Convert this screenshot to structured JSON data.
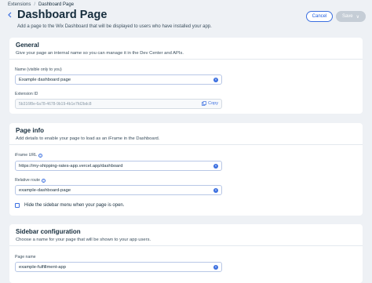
{
  "breadcrumbs": {
    "parent": "Extensions",
    "separator": "/",
    "current": "Dashboard Page"
  },
  "header": {
    "title": "Dashboard Page",
    "subtitle": "Add a page to the Wix Dashboard that will be displayed to users who have installed your app.",
    "cancel_label": "Cancel",
    "save_label": "Save",
    "save_chevron": "∨"
  },
  "general": {
    "title": "General",
    "description": "Give your page an internal name so you can manage it in the Dev Center and APIs.",
    "name_label": "Name (visible only to you)",
    "name_value": "Example dashboard page",
    "extension_id_label": "Extension ID",
    "extension_id_value": "5b316f8e-6a78-4678-9b19-4b1e7fd2bdc8",
    "copy_label": "Copy"
  },
  "page_info": {
    "title": "Page info",
    "description": "Add details to enable your page to load as an iFrame in the Dashboard.",
    "iframe_label": "iFrame URL",
    "iframe_value": "https://my-shipping-rates-app.vercel.app/dashboard",
    "route_label": "Relative route",
    "route_value": "example-dashboard-page",
    "hide_sidebar_label": "Hide the sidebar menu when your page is open."
  },
  "sidebar_config": {
    "title": "Sidebar configuration",
    "description": "Choose a name for your page that will be shown to your app users.",
    "page_name_label": "Page name",
    "page_name_value": "example-fulfillment-app"
  },
  "colors": {
    "accent": "#3b6fe0",
    "background": "#eef1f5",
    "save_disabled": "#c5cdd6"
  }
}
